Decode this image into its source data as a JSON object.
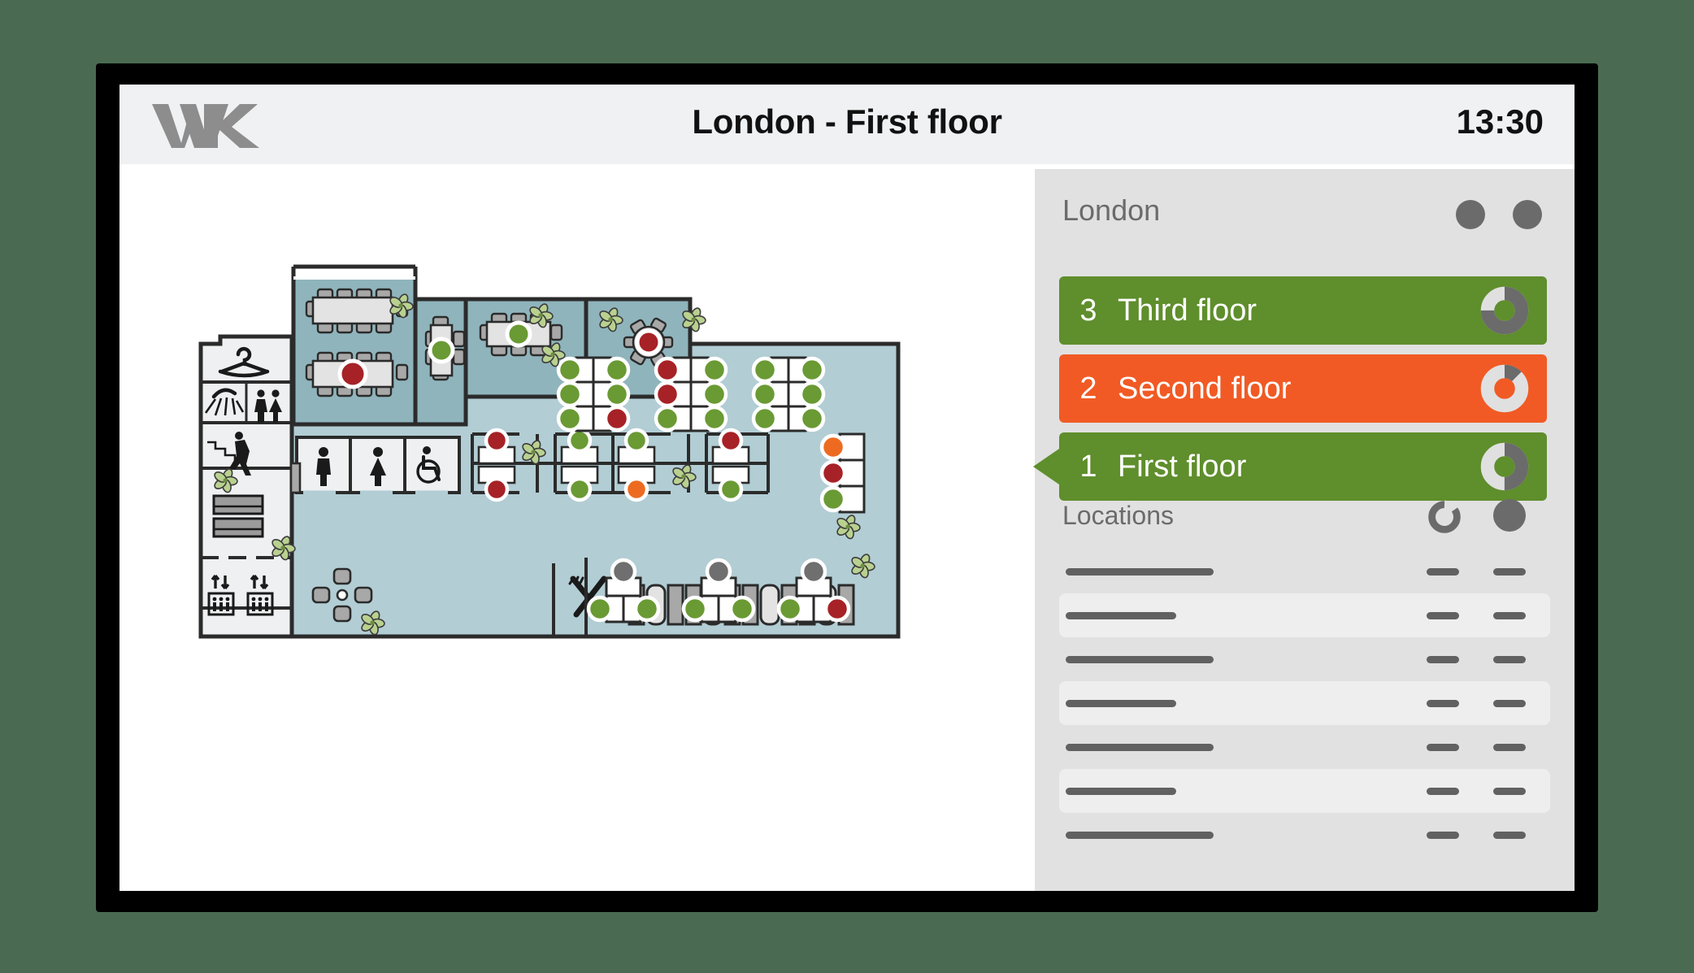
{
  "header": {
    "logo_text": "WK",
    "title": "London - First floor",
    "time": "13:30"
  },
  "sidebar": {
    "location_title": "London",
    "header_icons": [
      "dot-icon",
      "dot-icon"
    ],
    "floors": [
      {
        "number": "3",
        "label": "Third floor",
        "color": "#5f8e2c",
        "state": "available",
        "occupancy_pct": 75,
        "selected": false
      },
      {
        "number": "2",
        "label": "Second floor",
        "color": "#f15a24",
        "state": "busy",
        "occupancy_pct": 12,
        "selected": false
      },
      {
        "number": "1",
        "label": "First floor",
        "color": "#5f8e2c",
        "state": "available",
        "occupancy_pct": 50,
        "selected": true
      }
    ],
    "locations": {
      "title": "Locations",
      "col_icons": [
        "donut-icon",
        "dot-icon"
      ],
      "rows": [
        {
          "name_width": 182,
          "alt": false
        },
        {
          "name_width": 136,
          "alt": true
        },
        {
          "name_width": 182,
          "alt": false
        },
        {
          "name_width": 136,
          "alt": true
        },
        {
          "name_width": 182,
          "alt": false
        },
        {
          "name_width": 136,
          "alt": true
        },
        {
          "name_width": 182,
          "alt": false
        }
      ]
    }
  },
  "floorplan": {
    "colors": {
      "wall": "#2b2b2b",
      "open_floor": "#b2cdd4",
      "meeting_floor": "#8fb4bc",
      "service_floor": "#eef0f1",
      "desk_fill": "#ffffff",
      "table_fill": "#e3e3e3",
      "chair_fill": "#a8a8a8",
      "free": "#6a9a34",
      "occupied": "#a62226",
      "reserved": "#ed6b21",
      "unknown": "#6f6f6f",
      "plant": "#b9d18f"
    },
    "facilities": [
      {
        "icon": "coat-hanger-icon",
        "label": "Cloakroom"
      },
      {
        "icon": "shower-icon",
        "label": "Shower"
      },
      {
        "icon": "toilet-icon",
        "label": "Toilets"
      },
      {
        "icon": "stairs-icon",
        "label": "Stairs"
      },
      {
        "icon": "printer-icon",
        "label": "Printers"
      },
      {
        "icon": "elevator-icon",
        "label": "Elevator"
      },
      {
        "icon": "elevator-icon",
        "label": "Elevator"
      },
      {
        "icon": "male-toilet-icon",
        "label": "Men"
      },
      {
        "icon": "female-toilet-icon",
        "label": "Women"
      },
      {
        "icon": "accessible-toilet-icon",
        "label": "Accessible"
      },
      {
        "icon": "restaurant-icon",
        "label": "Restaurant"
      },
      {
        "icon": "lounge-icon",
        "label": "Lounge"
      }
    ],
    "meeting_rooms": [
      {
        "name": "boardroom-large-a",
        "seats": 10,
        "status": "free"
      },
      {
        "name": "boardroom-large-b",
        "seats": 10,
        "status": "occupied"
      },
      {
        "name": "meeting-room-small",
        "seats": 6,
        "status": "free"
      },
      {
        "name": "meeting-room-medium",
        "seats": 6,
        "status": "free"
      },
      {
        "name": "round-meeting-room",
        "seats": 6,
        "status": "occupied"
      }
    ],
    "desk_clusters": [
      {
        "name": "cluster-a",
        "rows": [
          [
            "free",
            "free"
          ],
          [
            "free",
            "free"
          ],
          [
            "free",
            "occupied"
          ]
        ]
      },
      {
        "name": "cluster-b",
        "rows": [
          [
            "occupied",
            "free"
          ],
          [
            "occupied",
            "free"
          ],
          [
            "free",
            "free"
          ]
        ]
      },
      {
        "name": "cluster-c",
        "rows": [
          [
            "free",
            "free"
          ],
          [
            "free",
            "free"
          ],
          [
            "free",
            "free"
          ]
        ]
      }
    ],
    "cubicle_block": {
      "name": "cubicle-row",
      "top": [
        "occupied",
        null,
        "free",
        "free",
        null,
        "occupied"
      ],
      "bottom": [
        "occupied",
        null,
        "free",
        "reserved",
        null,
        "free"
      ]
    },
    "wall_desk_column": {
      "name": "wall-desk-column",
      "statuses": [
        "reserved",
        "occupied",
        "free"
      ]
    },
    "bottom_desks": [
      {
        "name": "touchdown-a",
        "head": "unknown",
        "left": "free",
        "right": "free"
      },
      {
        "name": "touchdown-b",
        "head": "unknown",
        "left": "free",
        "right": "free"
      },
      {
        "name": "touchdown-c",
        "head": "unknown",
        "left": "free",
        "right": "occupied"
      }
    ],
    "canteen_benches": 11
  }
}
